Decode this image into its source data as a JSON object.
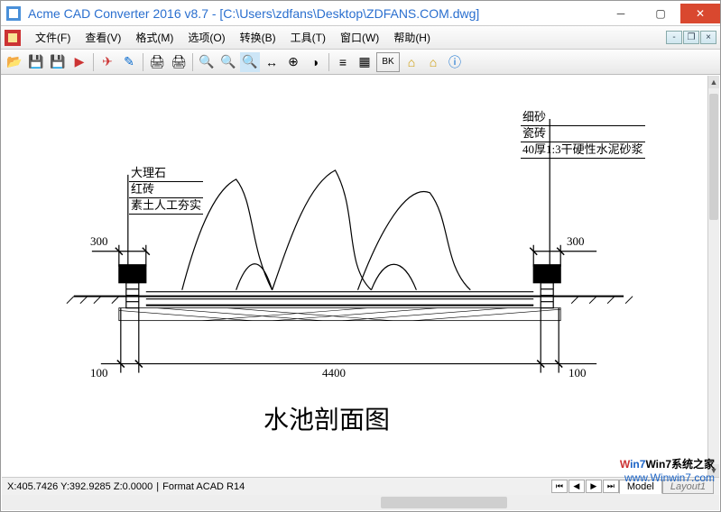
{
  "title": "Acme CAD Converter 2016 v8.7 - [C:\\Users\\zdfans\\Desktop\\ZDFANS.COM.dwg]",
  "menus": {
    "file": "文件(F)",
    "view": "查看(V)",
    "format": "格式(M)",
    "options": "选项(O)",
    "convert": "转换(B)",
    "tools": "工具(T)",
    "window": "窗口(W)",
    "help": "帮助(H)"
  },
  "status": {
    "coords": "X:405.7426 Y:392.9285 Z:0.0000",
    "sep": "|",
    "format": "Format ACAD R14"
  },
  "tabs": {
    "model": "Model",
    "layout": "Layout1"
  },
  "drawing": {
    "title": "水池剖面图",
    "left_text": {
      "a": "大理石",
      "b": "红砖",
      "c": "素土人工夯实"
    },
    "right_text": {
      "a": "细砂",
      "b": "瓷砖",
      "c": "40厚1:3干硬性水泥砂浆"
    },
    "dims": {
      "left300": "300",
      "right300": "300",
      "left100": "100",
      "mid4400": "4400",
      "right100": "100"
    }
  },
  "toolbar": {
    "bk": "BK"
  },
  "watermark": {
    "a": "Win7系统之家",
    "b": "www.Winwin7.com"
  }
}
